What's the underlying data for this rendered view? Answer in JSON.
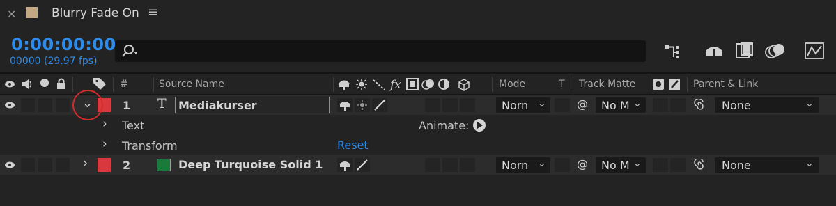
{
  "comp_tab": {
    "close": "×",
    "title": "Blurry Fade On",
    "menu": "≡",
    "swatch_color": "#c4a783"
  },
  "time": {
    "timecode": "0:00:00:00",
    "frames": "00000 (29.97 fps)"
  },
  "search": {
    "placeholder": ""
  },
  "header": {
    "hash": "#",
    "source_name": "Source Name",
    "mode": "Mode",
    "t": "T",
    "track_matte": "Track Matte",
    "parent_link": "Parent & Link"
  },
  "layers": [
    {
      "number": "1",
      "type_icon": "T",
      "name": "Mediakurser",
      "label_color": "#d9393c",
      "mode": "Norn",
      "track_matte": "No M",
      "parent": "None",
      "expanded": true
    },
    {
      "number": "2",
      "name": "Deep Turquoise Solid 1",
      "label_color": "#d9393c",
      "solid_color": "#1a7a3a",
      "mode": "Norn",
      "track_matte": "No M",
      "parent": "None",
      "expanded": false
    }
  ],
  "properties": {
    "text": "Text",
    "animate": "Animate:",
    "transform": "Transform",
    "reset": "Reset"
  }
}
